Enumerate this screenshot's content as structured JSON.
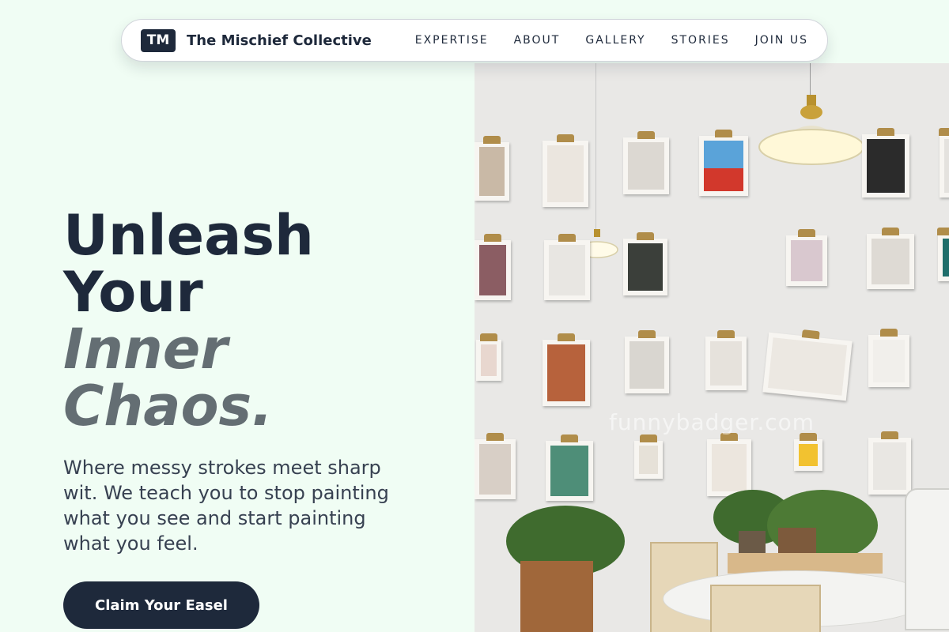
{
  "header": {
    "logo_text": "TM",
    "brand": "The Mischief Collective",
    "nav": [
      "EXPERTISE",
      "ABOUT",
      "GALLERY",
      "STORIES",
      "JOIN US"
    ]
  },
  "hero": {
    "title_lines": [
      "Unleash",
      "Your",
      "Inner",
      "Chaos."
    ],
    "subtitle": "Where messy strokes meet sharp wit. We teach you to stop painting what you see and start painting what you feel.",
    "cta_label": "Claim Your Easel"
  },
  "photo": {
    "watermark": "funnybadger.com"
  },
  "colors": {
    "background": "#f0fdf4",
    "primary": "#1e293b",
    "muted_title": "#646e73"
  }
}
